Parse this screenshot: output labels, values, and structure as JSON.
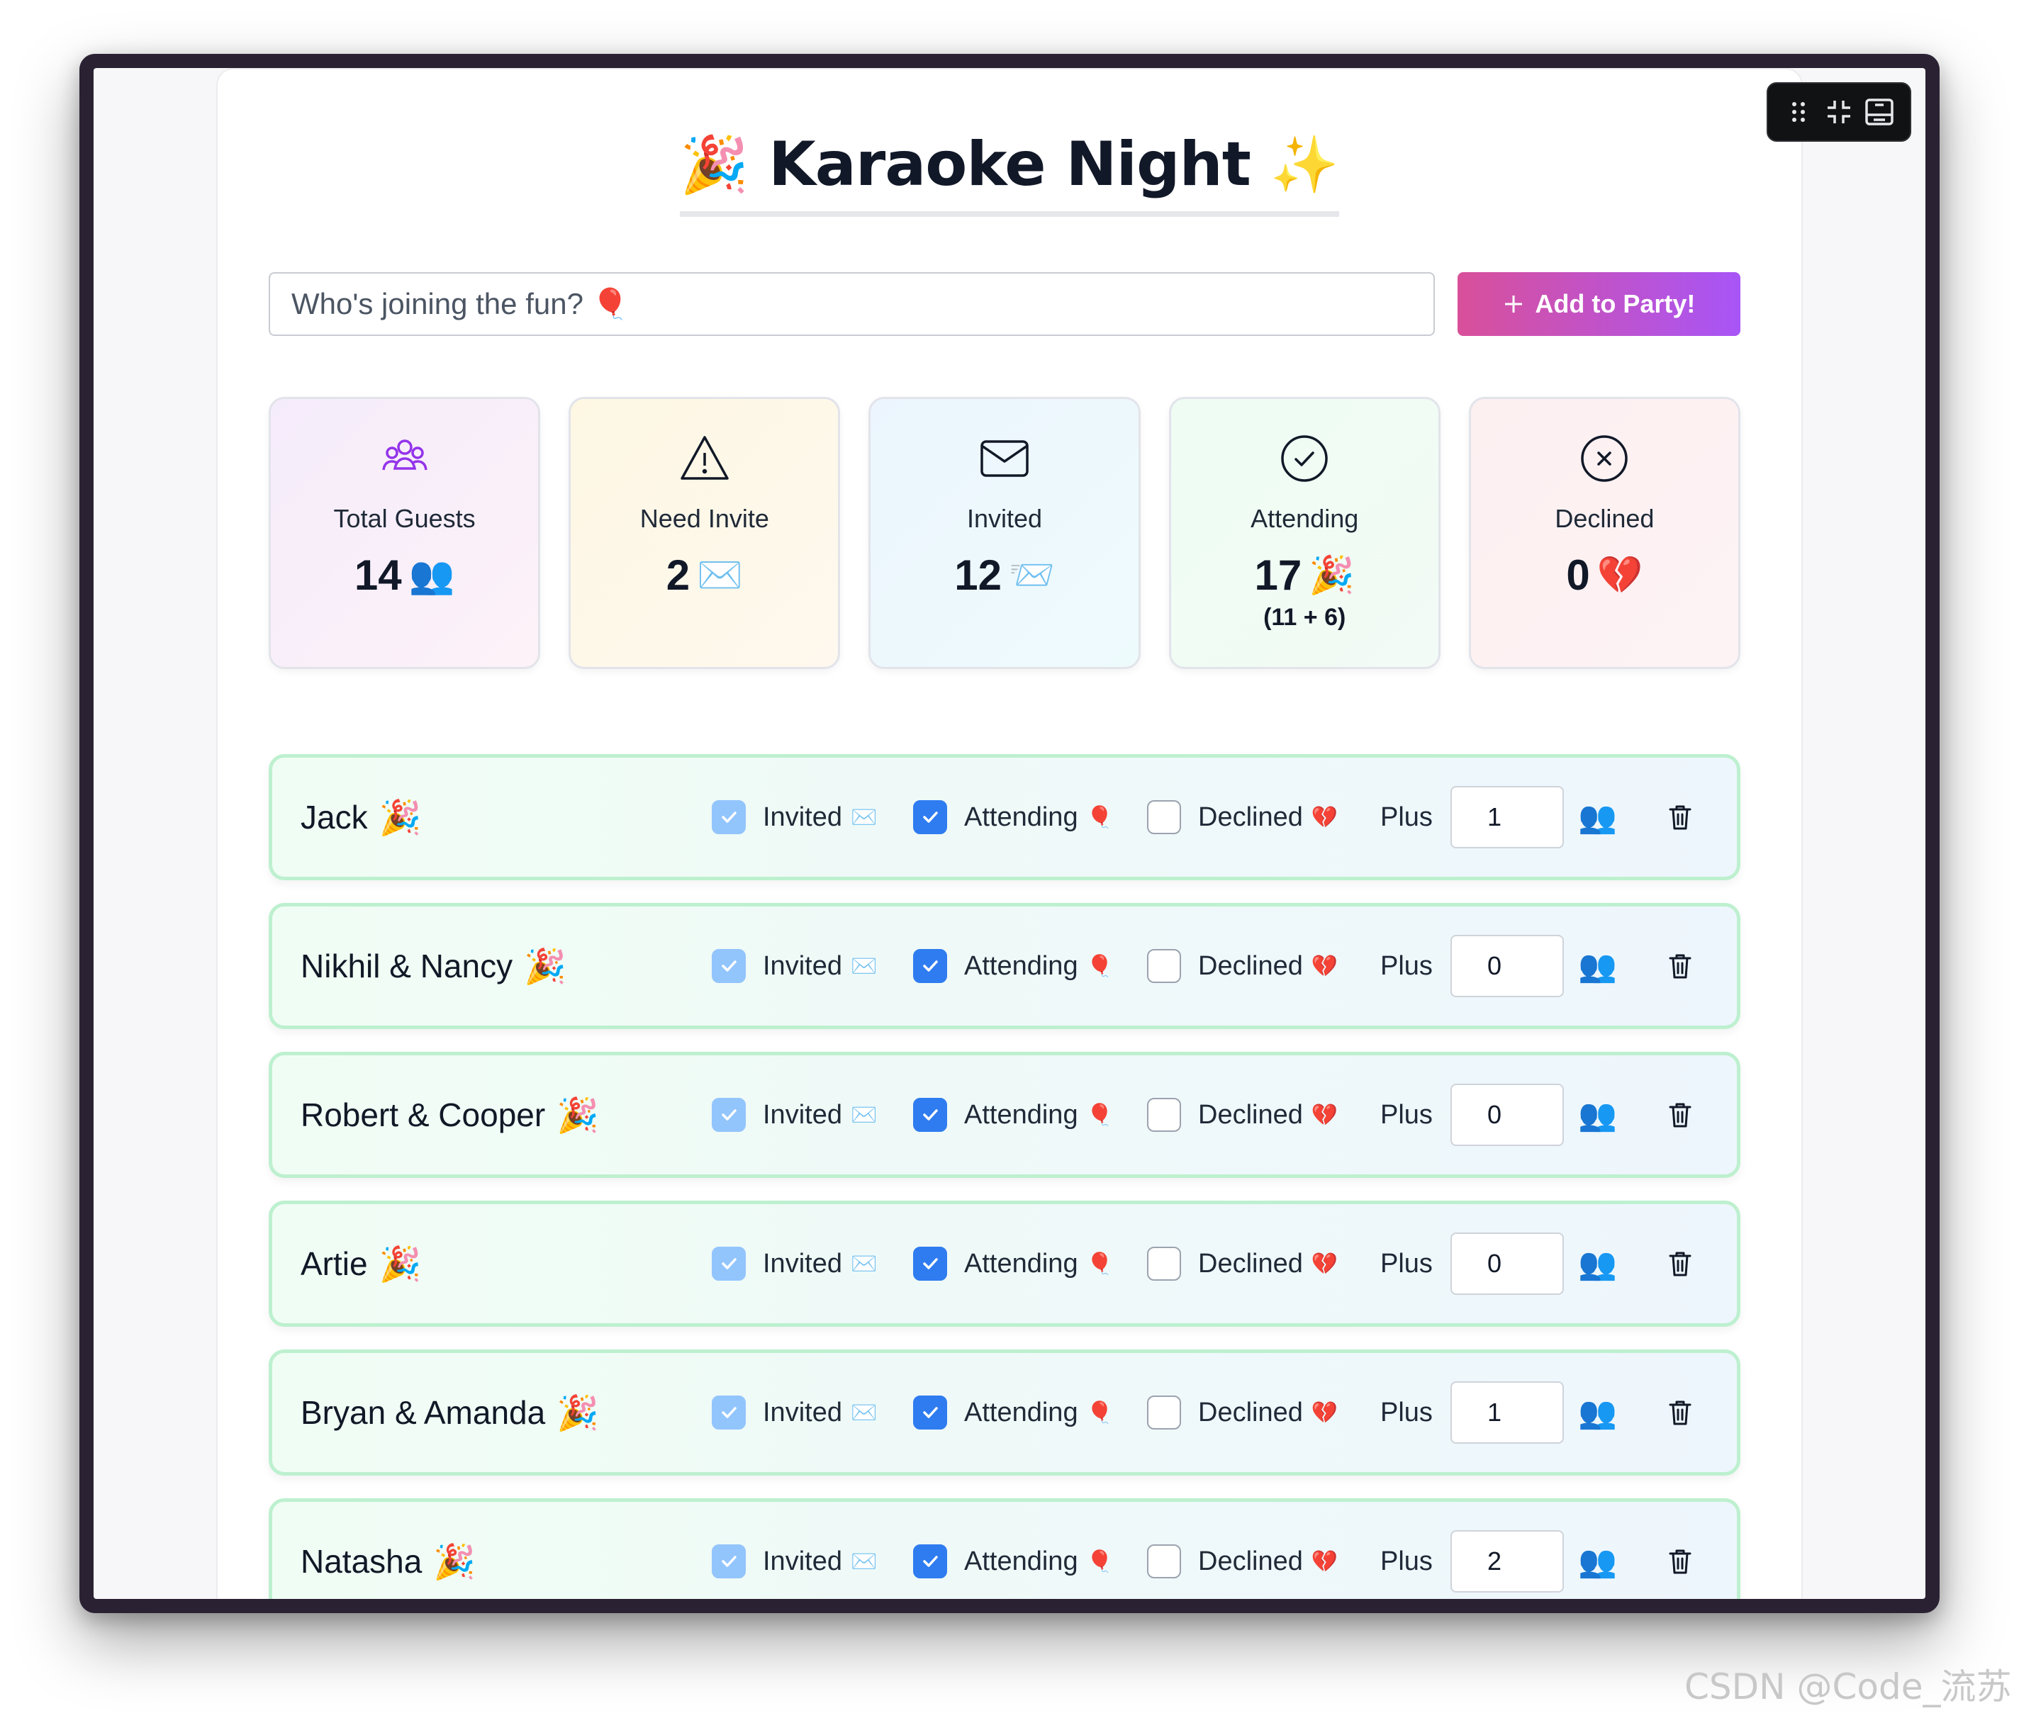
{
  "app": {
    "title": "Karaoke Night",
    "title_emoji_left": "🎉",
    "title_emoji_right": "✨"
  },
  "add_guest": {
    "placeholder": "Who's joining the fun? 🎈",
    "button_label": "Add to Party!",
    "button_icon": "plus-icon"
  },
  "stats": {
    "total": {
      "label": "Total Guests",
      "value": "14",
      "emoji": "👥",
      "icon": "users-icon",
      "color": "#9333ea"
    },
    "need_invite": {
      "label": "Need Invite",
      "value": "2",
      "emoji": "✉️",
      "icon": "alert-triangle-icon"
    },
    "invited": {
      "label": "Invited",
      "value": "12",
      "emoji": "📨",
      "icon": "mail-icon"
    },
    "attending": {
      "label": "Attending",
      "value": "17",
      "emoji": "🎉",
      "sub": "(11 + 6)",
      "icon": "check-circle-icon"
    },
    "declined": {
      "label": "Declined",
      "value": "0",
      "emoji": "💔",
      "icon": "x-circle-icon"
    }
  },
  "labels": {
    "invited": "Invited",
    "invited_emoji": "✉️",
    "attending": "Attending",
    "attending_emoji": "🎈",
    "declined": "Declined",
    "declined_emoji": "💔",
    "plus": "Plus",
    "people_emoji": "👥"
  },
  "guests": [
    {
      "name": "Jack",
      "emoji": "🎉",
      "invited": true,
      "attending": true,
      "declined": false,
      "plus": "1"
    },
    {
      "name": "Nikhil & Nancy",
      "emoji": "🎉",
      "invited": true,
      "attending": true,
      "declined": false,
      "plus": "0"
    },
    {
      "name": "Robert & Cooper",
      "emoji": "🎉",
      "invited": true,
      "attending": true,
      "declined": false,
      "plus": "0"
    },
    {
      "name": "Artie",
      "emoji": "🎉",
      "invited": true,
      "attending": true,
      "declined": false,
      "plus": "0"
    },
    {
      "name": "Bryan & Amanda",
      "emoji": "🎉",
      "invited": true,
      "attending": true,
      "declined": false,
      "plus": "1"
    },
    {
      "name": "Natasha",
      "emoji": "🎉",
      "invited": true,
      "attending": true,
      "declined": false,
      "plus": "2"
    }
  ],
  "colors": {
    "accent_pink": "#d9509a",
    "accent_purple": "#a855f7",
    "checkbox_blue": "#2f7cf0",
    "row_border": "#bdf0cf"
  },
  "watermark": "CSDN @Code_流苏"
}
